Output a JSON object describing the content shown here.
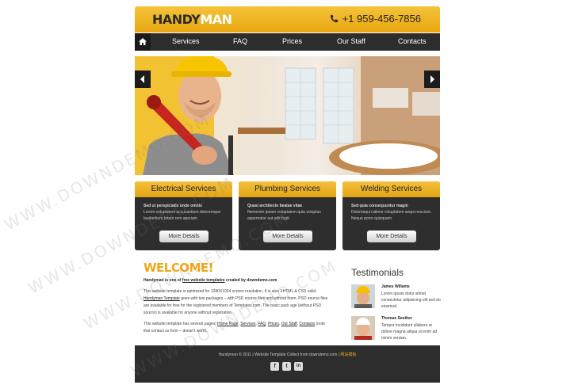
{
  "header": {
    "logo_part1": "HANDY",
    "logo_part2": "MAN",
    "phone": "+1 959-456-7856"
  },
  "nav": {
    "items": [
      "Services",
      "FAQ",
      "Prices",
      "Our Staff",
      "Contacts"
    ]
  },
  "services": [
    {
      "title": "Electrical Services",
      "subtitle": "Sed ut perspiciatis unde omnis",
      "text": "Lorem voluptatem accusantium doloremque laudantium totam rem aperiam.",
      "button": "More Details"
    },
    {
      "title": "Plumbing Services",
      "subtitle": "Quasi architecto beatae vitae",
      "text": "Nemenim ipsam voluptatem quia voluptas aspernatur aut odit fugit.",
      "button": "More Details"
    },
    {
      "title": "Welding Services",
      "subtitle": "Sed quia consequuntur magni",
      "text": "Doloresqui ratione voluptatem sequi nesciunt. Neque porro quisquam.",
      "button": "More Details"
    }
  ],
  "welcome": {
    "title": "WELCOME!",
    "intro_pre": "Handyman is one of ",
    "intro_link": "free website templates",
    "intro_post": " created by downdemo.com",
    "p1_a": "This website template is optimized for 1280X1024 screen resolution. It is also XHTML & CSS valid. ",
    "p1_link": "Handyman Template",
    "p1_b": " goes with two packages – with PSD source files and without them. PSD source files are available for free for the registered members of Templates.com. The basic pack age (without PSD source) is available for anyone without registration.",
    "p2_a": "This website template has several pages: ",
    "p2_links": [
      "Home Page",
      "Services",
      "FAQ",
      "Prices",
      "Our Staff",
      "Contacts"
    ],
    "p2_b": " (note that contact us form – doesn't work)."
  },
  "testimonials": {
    "title": "Testimonials",
    "items": [
      {
        "name": "James Wiliams",
        "text": "Lorem ipsum dolor sitmet consectetur adipisicing elit sed do eiusmod."
      },
      {
        "name": "Thomas Seether",
        "text": "Tempor incididunt ullabore et dolore magna aliqua ut enim ad minim veniam."
      }
    ]
  },
  "footer": {
    "text": "Handyman © 2011 | Website Template Collect from downdemo.com | ",
    "link": "网站模板",
    "social": [
      "f",
      "t",
      "in"
    ]
  },
  "watermark": "WWW.DOWNDEMO.COM",
  "colors": {
    "accent": "#f0a818",
    "dark": "#2d2d2d"
  }
}
